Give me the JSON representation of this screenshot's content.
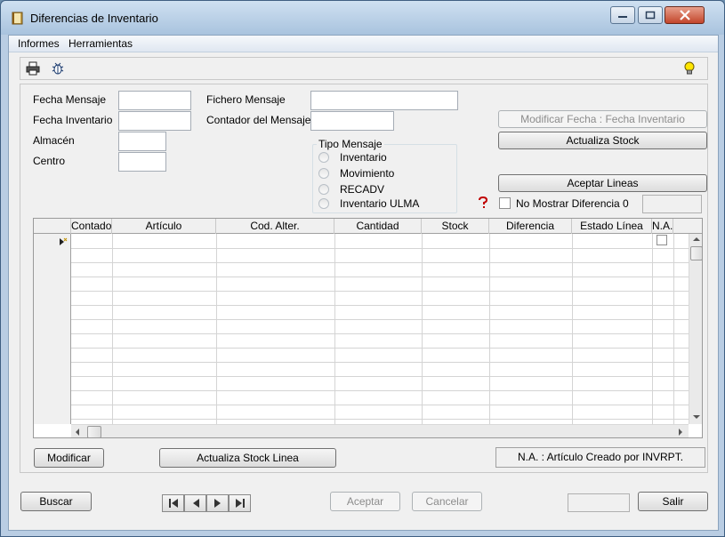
{
  "window": {
    "title": "Diferencias de Inventario"
  },
  "menu": {
    "informes": "Informes",
    "herramientas": "Herramientas"
  },
  "form": {
    "fecha_mensaje_label": "Fecha Mensaje",
    "fecha_inventario_label": "Fecha Inventario",
    "almacen_label": "Almacén",
    "centro_label": "Centro",
    "fichero_mensaje_label": "Fichero Mensaje",
    "contador_mensaje_label": "Contador del Mensaje",
    "fecha_mensaje_value": "",
    "fecha_inventario_value": "",
    "almacen_value": "",
    "centro_value": "",
    "fichero_mensaje_value": "",
    "contador_mensaje_value": ""
  },
  "tipo_mensaje": {
    "title": "Tipo Mensaje",
    "options": [
      "Inventario",
      "Movimiento",
      "RECADV",
      "Inventario ULMA"
    ]
  },
  "actions": {
    "modificar_fecha": "Modificar Fecha : Fecha Inventario",
    "actualiza_stock": "Actualiza Stock",
    "aceptar_lineas": "Aceptar Lineas",
    "no_mostrar_diferencia": "No Mostrar Diferencia 0"
  },
  "grid": {
    "columns": [
      "Contador",
      "Artículo",
      "Cod. Alter.",
      "Cantidad",
      "Stock",
      "Diferencia",
      "Estado Línea",
      "N.A."
    ]
  },
  "bottom": {
    "modificar": "Modificar",
    "actualiza_stock_linea": "Actualiza Stock Linea",
    "na_legend": "N.A. : Artículo Creado por INVRPT."
  },
  "footer": {
    "buscar": "Buscar",
    "aceptar": "Aceptar",
    "cancelar": "Cancelar",
    "salir": "Salir"
  }
}
